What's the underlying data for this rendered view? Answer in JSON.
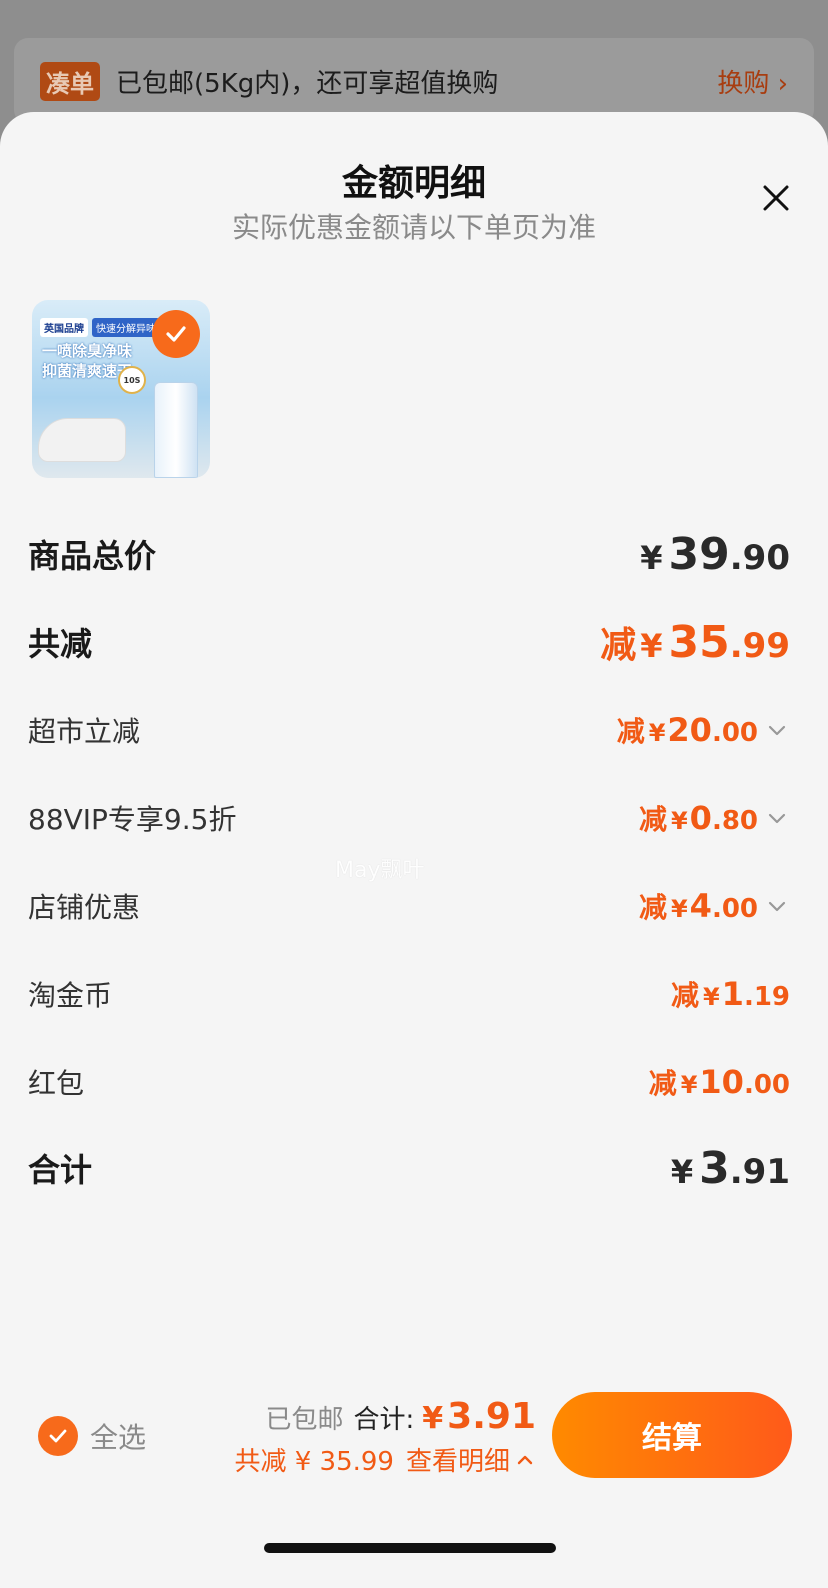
{
  "background": {
    "tag": "凑单",
    "text": "已包邮(5Kg内)，还可享超值换购",
    "link": "换购 ›"
  },
  "sheet": {
    "title": "金额明细",
    "subtitle": "实际优惠金额请以下单页为准",
    "close_icon": "close-icon"
  },
  "product": {
    "tag_brand": "英国品牌",
    "tag_feature": "快速分解异味",
    "line1": "一喷除臭净味",
    "line2": "抑菌清爽速干",
    "badge": "10S",
    "selected": true
  },
  "rows": [
    {
      "label": "商品总价",
      "prefix": "",
      "yen": "¥",
      "int": "39",
      "dec": ".90",
      "color": "#2a2a2a",
      "chevron": false
    },
    {
      "label": "共减",
      "prefix": "减",
      "yen": "¥",
      "int": "35",
      "dec": ".99",
      "color": "#f15a15",
      "chevron": false
    },
    {
      "label": "超市立减",
      "prefix": "减",
      "yen": "¥",
      "int": "20",
      "dec": ".00",
      "color": "#f15a15",
      "chevron": true
    },
    {
      "label": "88VIP专享9.5折",
      "prefix": "减",
      "yen": "¥",
      "int": "0",
      "dec": ".80",
      "color": "#f15a15",
      "chevron": true
    },
    {
      "label": "店铺优惠",
      "prefix": "减",
      "yen": "¥",
      "int": "4",
      "dec": ".00",
      "color": "#f15a15",
      "chevron": true
    },
    {
      "label": "淘金币",
      "prefix": "减",
      "yen": "¥",
      "int": "1",
      "dec": ".19",
      "color": "#f15a15",
      "chevron": false
    },
    {
      "label": "红包",
      "prefix": "减",
      "yen": "¥",
      "int": "10",
      "dec": ".00",
      "color": "#f15a15",
      "chevron": false
    },
    {
      "label": "合计",
      "prefix": "",
      "yen": "¥",
      "int": "3",
      "dec": ".91",
      "color": "#2a2a2a",
      "chevron": false
    }
  ],
  "watermark": "May飘叶",
  "footer": {
    "select_all": "全选",
    "shipping": "已包邮",
    "total_label": "合计:",
    "total_yen": "¥",
    "total_value": "3.91",
    "discount_text": "共减 ¥ 35.99",
    "detail_link": "查看明细",
    "checkout": "结算"
  },
  "colors": {
    "accent": "#f15a15",
    "check": "#f76a1b",
    "checkout_start": "#ff8a00",
    "checkout_end": "#ff5a1a"
  }
}
